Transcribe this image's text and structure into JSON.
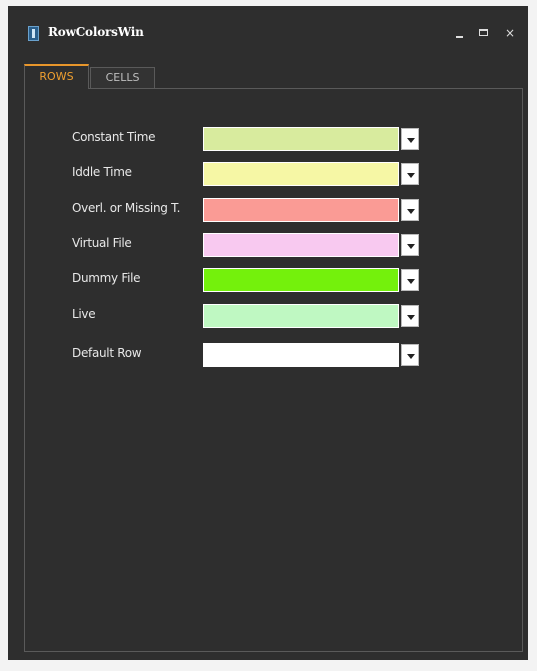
{
  "window": {
    "title": "RowColorsWin",
    "icon": "app-icon",
    "controls": {
      "minimize_icon": "minimize-icon",
      "maximize_icon": "maximize-icon",
      "close_label": "×"
    }
  },
  "tabs": [
    {
      "label": "ROWS",
      "active": true,
      "accent_color": "#e8962b"
    },
    {
      "label": "CELLS",
      "active": false
    }
  ],
  "rows": [
    {
      "label": "Constant Time",
      "color": "#d8eb9e"
    },
    {
      "label": "Iddle Time",
      "color": "#f6f7a5"
    },
    {
      "label": "Overl. or Missing T.",
      "color": "#fa9b95"
    },
    {
      "label": "Virtual File",
      "color": "#f8c9f0"
    },
    {
      "label": "Dummy File",
      "color": "#74f10c"
    },
    {
      "label": "Live",
      "color": "#bff8c2"
    },
    {
      "label": "Default Row",
      "color": "#ffffff"
    }
  ],
  "theme": {
    "window_background": "#2e2e2e",
    "page_background": "#f3f3f3",
    "panel_border": "#5a5a5a",
    "text_color": "#e8e8e8"
  }
}
